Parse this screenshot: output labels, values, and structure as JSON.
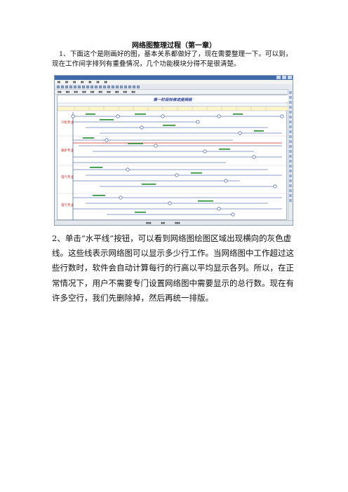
{
  "doc": {
    "title": "网络图整理过程（第一章）",
    "para1_num": "1",
    "para1_text": "、下面这个是刚画好的图，基本关系都做好了，现在需要整理一下。可以到，现在工作间字排列有重叠情况，几个功能模块分得不是很清楚。",
    "para2_num": "2",
    "para2_text": "、单击“水平线”按钮，可以看到网络图绘图区域出现横向的灰色虚线。这些线表示网络图可以显示多少行工作。当网络图中工作超过这些行数时，软件会自动计算每行的行高以平均显示各列。所以，在正常情况下，用户不需要专门设置网络图中需要显示的总行数。现在有许多空行，我们先删除掉，然后再统一排版。"
  },
  "screenshot": {
    "chart_title": "第一阶段检修进度网络",
    "lane_labels": [
      "汽机专业",
      "锅炉专业",
      "电气专业",
      "电气专业"
    ],
    "accent_colors": {
      "titlebar": "#3e6aa8",
      "arrow_red": "#d42020",
      "node": "#1a3f8a",
      "label_green": "#1f8a2c"
    }
  }
}
